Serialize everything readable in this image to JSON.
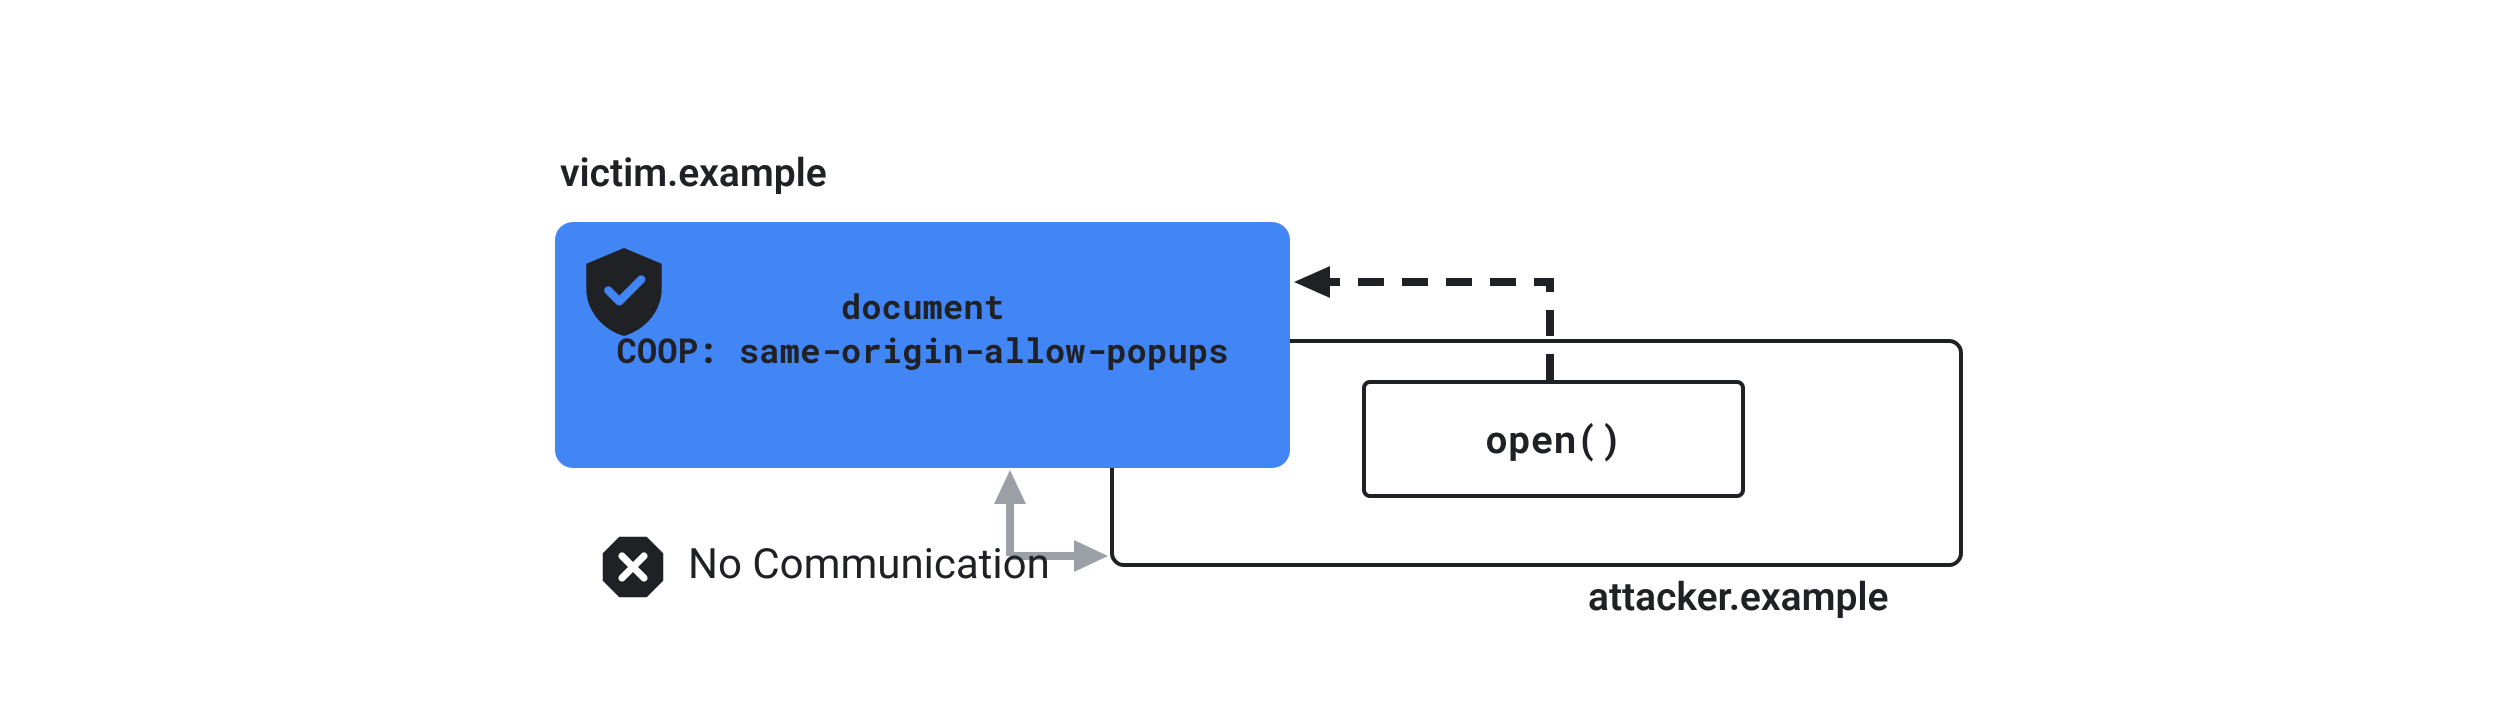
{
  "victim": {
    "title": "victim.example",
    "doc_label": "document",
    "coop_line": "COOP: same-origin-allow-popups"
  },
  "attacker": {
    "title": "attacker.example",
    "open_label": "open()"
  },
  "status": {
    "no_comm": "No Communication"
  },
  "colors": {
    "victim_bg": "#4285f4",
    "text": "#202124",
    "arrow_grey": "#9aa0a6"
  }
}
